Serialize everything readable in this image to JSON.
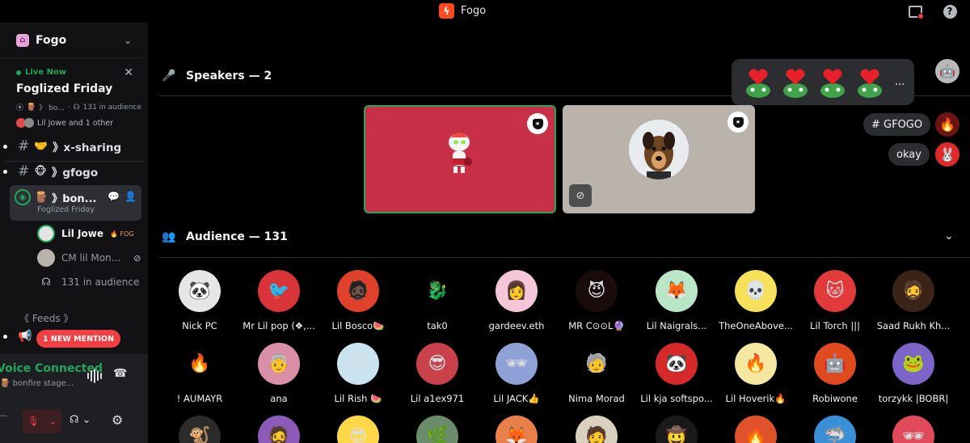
{
  "titlebar": {
    "app_name": "Fogo",
    "logo_glyph": "ϟ"
  },
  "sidebar": {
    "server_name": "Fogo",
    "live": {
      "badge": "Live Now",
      "title": "Foglized Friday",
      "meta_channel": "》 bo...",
      "meta_audience": "131 in audience",
      "users_text": "Lil Jowe and 1 other"
    },
    "channels": [
      {
        "emoji": "🤝",
        "name": "》x-sharing"
      },
      {
        "emoji": "🐵",
        "name": "》gfogo"
      }
    ],
    "active_channel": {
      "emoji": "🪵",
      "name": "》bon...",
      "subtitle": "Foglized Friday"
    },
    "members": [
      {
        "name": "Lil Jowe",
        "tag": "🔥 FOG"
      },
      {
        "name": "CM lil Mon..."
      }
    ],
    "audience_count_text": "131 in audience",
    "feeds_label": "《 Feeds 》",
    "mention_label": "1 NEW MENTION",
    "voice": {
      "status": "Voice Connected",
      "channel": "bonfire stage...",
      "user_label": "..."
    }
  },
  "main": {
    "speakers_label": "Speakers — 2",
    "audience_label": "Audience — 131",
    "reactions_more": "...",
    "chat": [
      {
        "text": "# GFOGO"
      },
      {
        "text": "okay"
      }
    ],
    "audience": [
      {
        "name": "Nick PC",
        "bg": "#e6e6e6",
        "glyph": "🐼"
      },
      {
        "name": "Mr Lil pop (❖,...",
        "bg": "#d8343a",
        "glyph": "🐦"
      },
      {
        "name": "Lil Bosco🍉",
        "bg": "#e0412a",
        "glyph": "🧔🏿"
      },
      {
        "name": "tak0",
        "bg": "#000000",
        "glyph": "🐉"
      },
      {
        "name": "gardeev.eth",
        "bg": "#f4c6d8",
        "glyph": "👩"
      },
      {
        "name": "MR C⊙⊙L🔮",
        "bg": "#1a0c0c",
        "glyph": "😈"
      },
      {
        "name": "Lil Naigrals...",
        "bg": "#b8e6c6",
        "glyph": "🦊"
      },
      {
        "name": "TheOneAbove...",
        "bg": "#f7e15a",
        "glyph": "💀"
      },
      {
        "name": "Lil Torch |||",
        "bg": "#e23a3a",
        "glyph": "🐱"
      },
      {
        "name": "Saad Rukh Kh...",
        "bg": "#3a2418",
        "glyph": "🧔"
      },
      {
        "name": "! AUMAYR",
        "bg": "#000000",
        "glyph": "🔥"
      },
      {
        "name": "ana",
        "bg": "#d98fa5",
        "glyph": "👵"
      },
      {
        "name": "Lil Rish 🍉",
        "bg": "#c9e4ee",
        "glyph": "🐱"
      },
      {
        "name": "Lil a1ex971",
        "bg": "#c9414a",
        "glyph": "😎"
      },
      {
        "name": "Lil JACK👍",
        "bg": "#8fa2d8",
        "glyph": "🕶"
      },
      {
        "name": "Nima Morad",
        "bg": "#000000",
        "glyph": "🧓"
      },
      {
        "name": "Lil kja softspo...",
        "bg": "#d62a2a",
        "glyph": "🐼"
      },
      {
        "name": "Lil Hoverik🔥",
        "bg": "#f5e7a0",
        "glyph": "🔥"
      },
      {
        "name": "Robiwone",
        "bg": "#e04a1e",
        "glyph": "🤖"
      },
      {
        "name": "torzykk |BOBR|",
        "bg": "#7c64c8",
        "glyph": "🐸"
      }
    ],
    "audience_row3": [
      {
        "bg": "#2b2b2b",
        "glyph": "🐒"
      },
      {
        "bg": "#8e5ab8",
        "glyph": "🧔"
      },
      {
        "bg": "#ffd84a",
        "glyph": "😎"
      },
      {
        "bg": "#6a8c6a",
        "glyph": "🌿"
      },
      {
        "bg": "#e8804a",
        "glyph": "🦊"
      },
      {
        "bg": "#d9d0c0",
        "glyph": "🧑"
      },
      {
        "bg": "#1a1a1a",
        "glyph": "🤠"
      },
      {
        "bg": "#e0522a",
        "glyph": "🔥"
      },
      {
        "bg": "#3a8fd6",
        "glyph": "🦈"
      },
      {
        "bg": "#e04a5a",
        "glyph": "🕶"
      },
      {
        "bg": "#8a4ad6",
        "glyph": "🐱"
      }
    ]
  }
}
